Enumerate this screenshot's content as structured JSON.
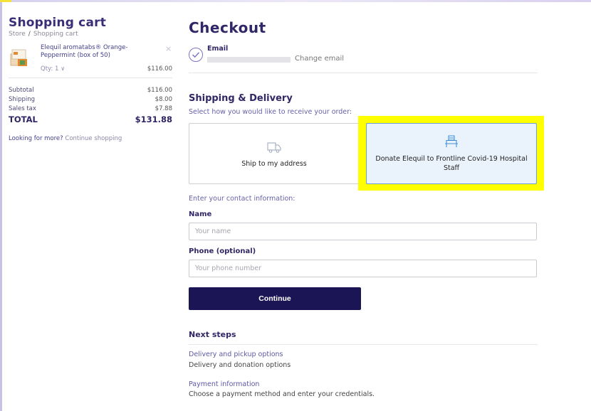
{
  "cart": {
    "title": "Shopping cart",
    "breadcrumb": [
      "Store",
      "/",
      "Shopping cart"
    ],
    "item": {
      "name": "Elequil aromatabs® Orange-Peppermint (box of 50)",
      "remove_glyph": "×",
      "quantity": "Qty: 1 ∨",
      "price": "$116.00",
      "thumbnail_icon": "product-box-icon"
    },
    "summary": [
      {
        "label": "Subtotal",
        "value": "$116.00"
      },
      {
        "label": "Shipping",
        "value": "$8.00"
      },
      {
        "label": "Sales tax",
        "value": "$7.88"
      }
    ],
    "total": {
      "label": "TOTAL",
      "value": "$131.88"
    },
    "more_text": "Looking for more?",
    "more_link": "Continue shopping"
  },
  "checkout": {
    "title": "Checkout",
    "email": {
      "label": "Email",
      "change_link": "Change email",
      "check_icon": "check-circle-icon"
    },
    "shipping": {
      "title": "Shipping & Delivery",
      "subtitle": "Select how you would like to receive your order:",
      "options": [
        {
          "label": "Ship to my address",
          "icon": "truck-icon",
          "selected": false
        },
        {
          "label": "Donate Elequil to Frontline Covid-19 Hospital Staff",
          "icon": "hospital-bed-icon",
          "selected": true
        }
      ]
    },
    "contact": {
      "subtitle": "Enter your contact information:",
      "name_label": "Name",
      "name_placeholder": "Your name",
      "phone_label": "Phone (optional)",
      "phone_placeholder": "Your phone number"
    },
    "continue_label": "Continue",
    "next_steps": {
      "title": "Next steps",
      "steps": [
        {
          "title": "Delivery and pickup options",
          "description": "Delivery and donation options"
        },
        {
          "title": "Payment information",
          "description": "Choose a payment method and enter your credentials."
        }
      ]
    }
  },
  "colors": {
    "accent": "#2f2766",
    "button": "#1c1555",
    "selected_bg": "#eaf3fc",
    "highlight": "#ffff00"
  }
}
